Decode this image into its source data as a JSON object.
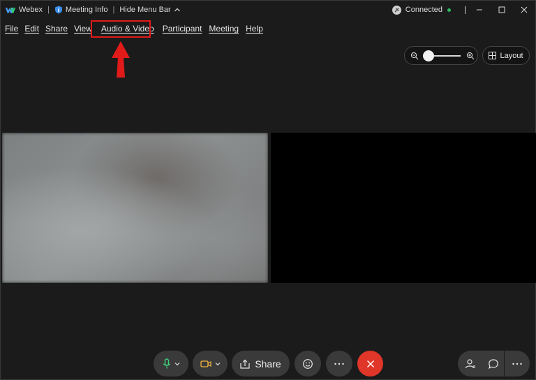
{
  "titlebar": {
    "app_name": "Webex",
    "meeting_info": "Meeting Info",
    "hide_menu": "Hide Menu Bar",
    "status": "Connected",
    "status_color": "#2db85f"
  },
  "menu": {
    "items": [
      "File",
      "Edit",
      "Share",
      "View",
      "Audio & Video",
      "Participant",
      "Meeting",
      "Help"
    ],
    "highlighted": "Audio & Video",
    "highlight_color": "#e11a1a"
  },
  "view": {
    "layout_label": "Layout",
    "zoom_level": 0.0
  },
  "controls": {
    "share_label": "Share",
    "leave_color": "#e0362a",
    "icons": [
      "microphone-icon",
      "video-camera-icon",
      "share-icon",
      "reactions-icon",
      "more-icon",
      "leave-icon",
      "participants-icon",
      "chat-icon",
      "more-icon"
    ]
  }
}
